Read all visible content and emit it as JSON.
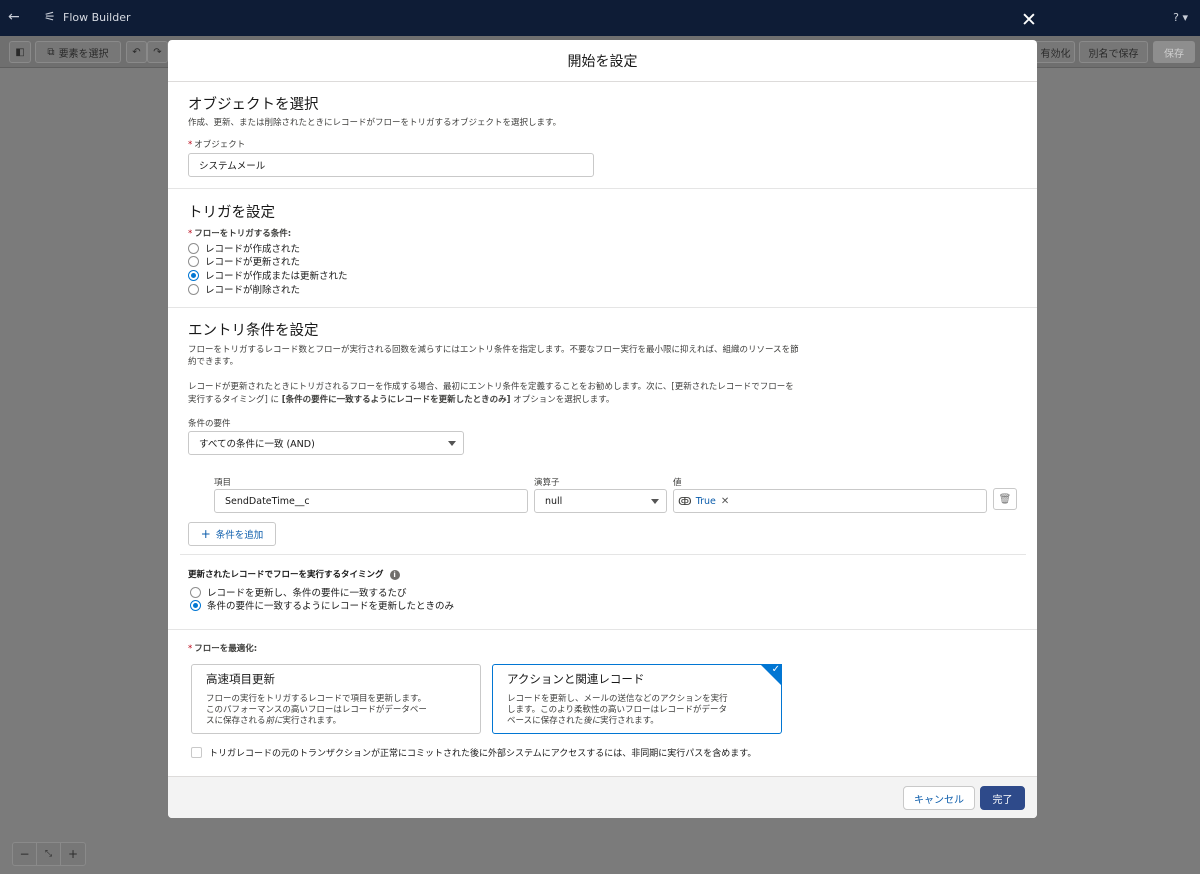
{
  "app": {
    "title": "Flow Builder",
    "help": "? ▾"
  },
  "toolbar": {
    "select_elements": "要素を選択",
    "activate": "有効化",
    "save_as": "別名で保存",
    "save": "保存"
  },
  "modal": {
    "title": "開始を設定",
    "object_section": {
      "heading": "オブジェクトを選択",
      "help": "作成、更新、または削除されたときにレコードがフローをトリガするオブジェクトを選択します。",
      "field_label": "オブジェクト",
      "field_value": "システムメール"
    },
    "trigger_section": {
      "heading": "トリガを設定",
      "group_label": "フローをトリガする条件:",
      "options": [
        {
          "label": "レコードが作成された",
          "checked": false
        },
        {
          "label": "レコードが更新された",
          "checked": false
        },
        {
          "label": "レコードが作成または更新された",
          "checked": true
        },
        {
          "label": "レコードが削除された",
          "checked": false
        }
      ]
    },
    "entry_section": {
      "heading": "エントリ条件を設定",
      "help1_line1": "フローをトリガするレコード数とフローが実行される回数を減らすにはエントリ条件を指定します。不要なフロー実行を最小限に抑えれば、組織のリソースを節",
      "help1_line2": "約できます。",
      "help2_line1": "レコードが更新されたときにトリガされるフローを作成する場合、最初にエントリ条件を定義することをお勧めします。次に、[更新されたレコードでフローを",
      "help2_line2_a": "実行するタイミング] に ",
      "help2_line2_b": "[条件の要件に一致するようにレコードを更新したときのみ]",
      "help2_line2_c": " オプションを選択します。",
      "requirement_label": "条件の要件",
      "requirement_value": "すべての条件に一致 (AND)",
      "col_field": "項目",
      "col_operator": "演算子",
      "col_value": "値",
      "row_field": "SendDateTime__c",
      "row_operator": "null",
      "row_value": "True",
      "add_condition": "条件を追加"
    },
    "timing_section": {
      "label": "更新されたレコードでフローを実行するタイミング",
      "options": [
        {
          "label": "レコードを更新し、条件の要件に一致するたび",
          "checked": false
        },
        {
          "label": "条件の要件に一致するようにレコードを更新したときのみ",
          "checked": true
        }
      ]
    },
    "optimize_section": {
      "label": "フローを最適化:",
      "card1_title": "高速項目更新",
      "card1_desc_1": "フローの実行をトリガするレコードで項目を更新します。",
      "card1_desc_2": "このパフォーマンスの高いフローはレコードがデータベー",
      "card1_desc_3a": "スに保存される",
      "card1_desc_3b": "前に",
      "card1_desc_3c": "実行されます。",
      "card2_title": "アクションと関連レコード",
      "card2_desc_1": "レコードを更新し、メールの送信などのアクションを実行",
      "card2_desc_2": "します。このより柔軟性の高いフローはレコードがデータ",
      "card2_desc_3a": "ベースに保存された",
      "card2_desc_3b": "後に",
      "card2_desc_3c": "実行されます。",
      "async_checkbox": "トリガレコードの元のトランザクションが正常にコミットされた後に外部システムにアクセスするには、非同期に実行パスを含めます。"
    },
    "footer": {
      "cancel": "キャンセル",
      "done": "完了"
    }
  }
}
